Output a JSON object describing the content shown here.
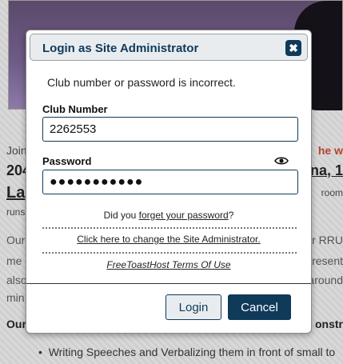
{
  "background": {
    "join": "Join",
    "date_left": "204",
    "link_left": "La",
    "runs": "runs",
    "para1": "Our",
    "para2": "me",
    "para3": "also",
    "para4": "min",
    "heading": "Our",
    "bullet": "Writing Speeches and Verbalizing them in front of small to",
    "right_red": "he w",
    "right_date": "na, 1",
    "right_room": "room",
    "right_rru": "r RRU",
    "right_resent": "resent",
    "right_around": "around",
    "right_onstr": "onstr"
  },
  "dialog": {
    "title": "Login as Site Administrator",
    "close_glyph": "✖",
    "error": "Club number or password is incorrect.",
    "club_label": "Club Number",
    "club_value": "2262553",
    "password_label": "Password",
    "password_value": "●●●●●●●●●●●",
    "forgot_prefix": "Did you ",
    "forgot_link": "forget your password",
    "forgot_suffix": "?",
    "change_admin": "Click here to change the Site Administrator.",
    "terms": "FreeToastHost Terms Of Use",
    "login_label": "Login",
    "cancel_label": "Cancel"
  }
}
